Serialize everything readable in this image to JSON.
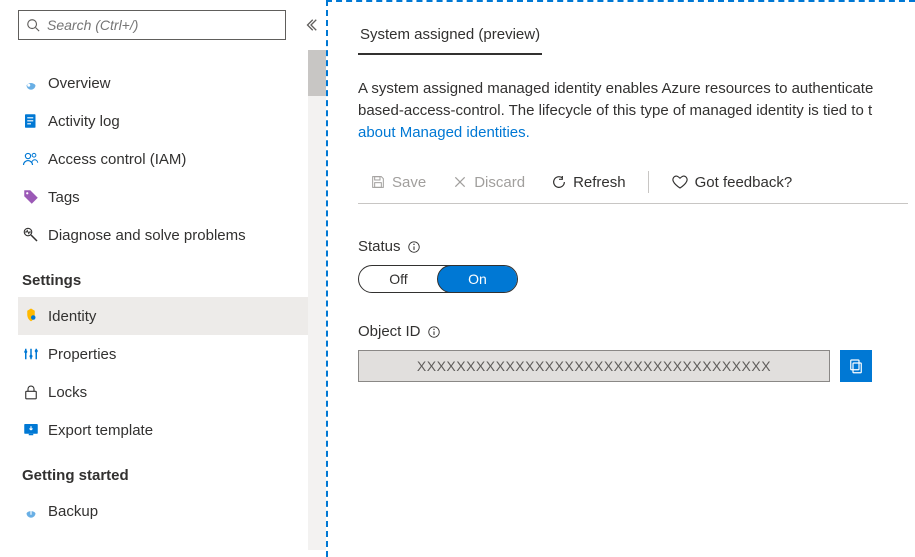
{
  "search": {
    "placeholder": "Search (Ctrl+/)"
  },
  "sidebar": {
    "items": [
      {
        "label": "Overview"
      },
      {
        "label": "Activity log"
      },
      {
        "label": "Access control (IAM)"
      },
      {
        "label": "Tags"
      },
      {
        "label": "Diagnose and solve problems"
      }
    ],
    "sections": [
      {
        "title": "Settings",
        "items": [
          {
            "label": "Identity"
          },
          {
            "label": "Properties"
          },
          {
            "label": "Locks"
          },
          {
            "label": "Export template"
          }
        ]
      },
      {
        "title": "Getting started",
        "items": [
          {
            "label": "Backup"
          }
        ]
      }
    ]
  },
  "main": {
    "tab": "System assigned (preview)",
    "desc1": "A system assigned managed identity enables Azure resources to authenticate ",
    "desc2": "based-access-control. The lifecycle of this type of managed identity is tied to t",
    "link": "about Managed identities.",
    "toolbar": {
      "save": "Save",
      "discard": "Discard",
      "refresh": "Refresh",
      "feedback": "Got feedback?"
    },
    "status": {
      "label": "Status",
      "off": "Off",
      "on": "On",
      "value": "On"
    },
    "objectid": {
      "label": "Object ID",
      "value": "XXXXXXXXXXXXXXXXXXXXXXXXXXXXXXXXXXXX"
    }
  },
  "colors": {
    "accent": "#0078d4"
  }
}
